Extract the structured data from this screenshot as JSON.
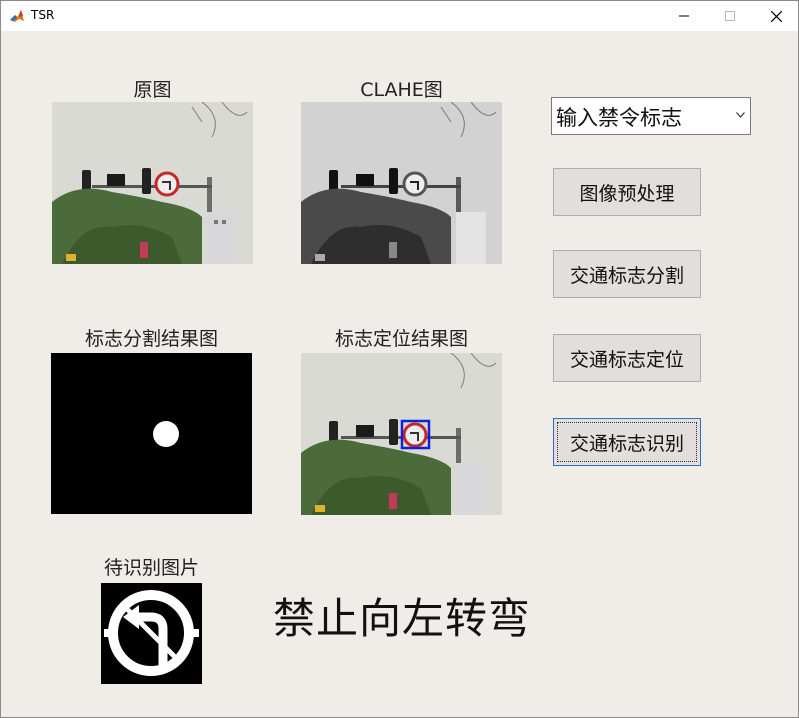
{
  "window": {
    "title": "TSR"
  },
  "panels": {
    "original_title": "原图",
    "clahe_title": "CLAHE图",
    "segmentation_title": "标志分割结果图",
    "localization_title": "标志定位结果图",
    "to_recognize_title": "待识别图片"
  },
  "controls": {
    "sign_type_select": {
      "selected": "输入禁令标志"
    },
    "buttons": {
      "preprocess": "图像预处理",
      "segment": "交通标志分割",
      "locate": "交通标志定位",
      "recognize": "交通标志识别"
    }
  },
  "result": {
    "text": "禁止向左转弯"
  }
}
